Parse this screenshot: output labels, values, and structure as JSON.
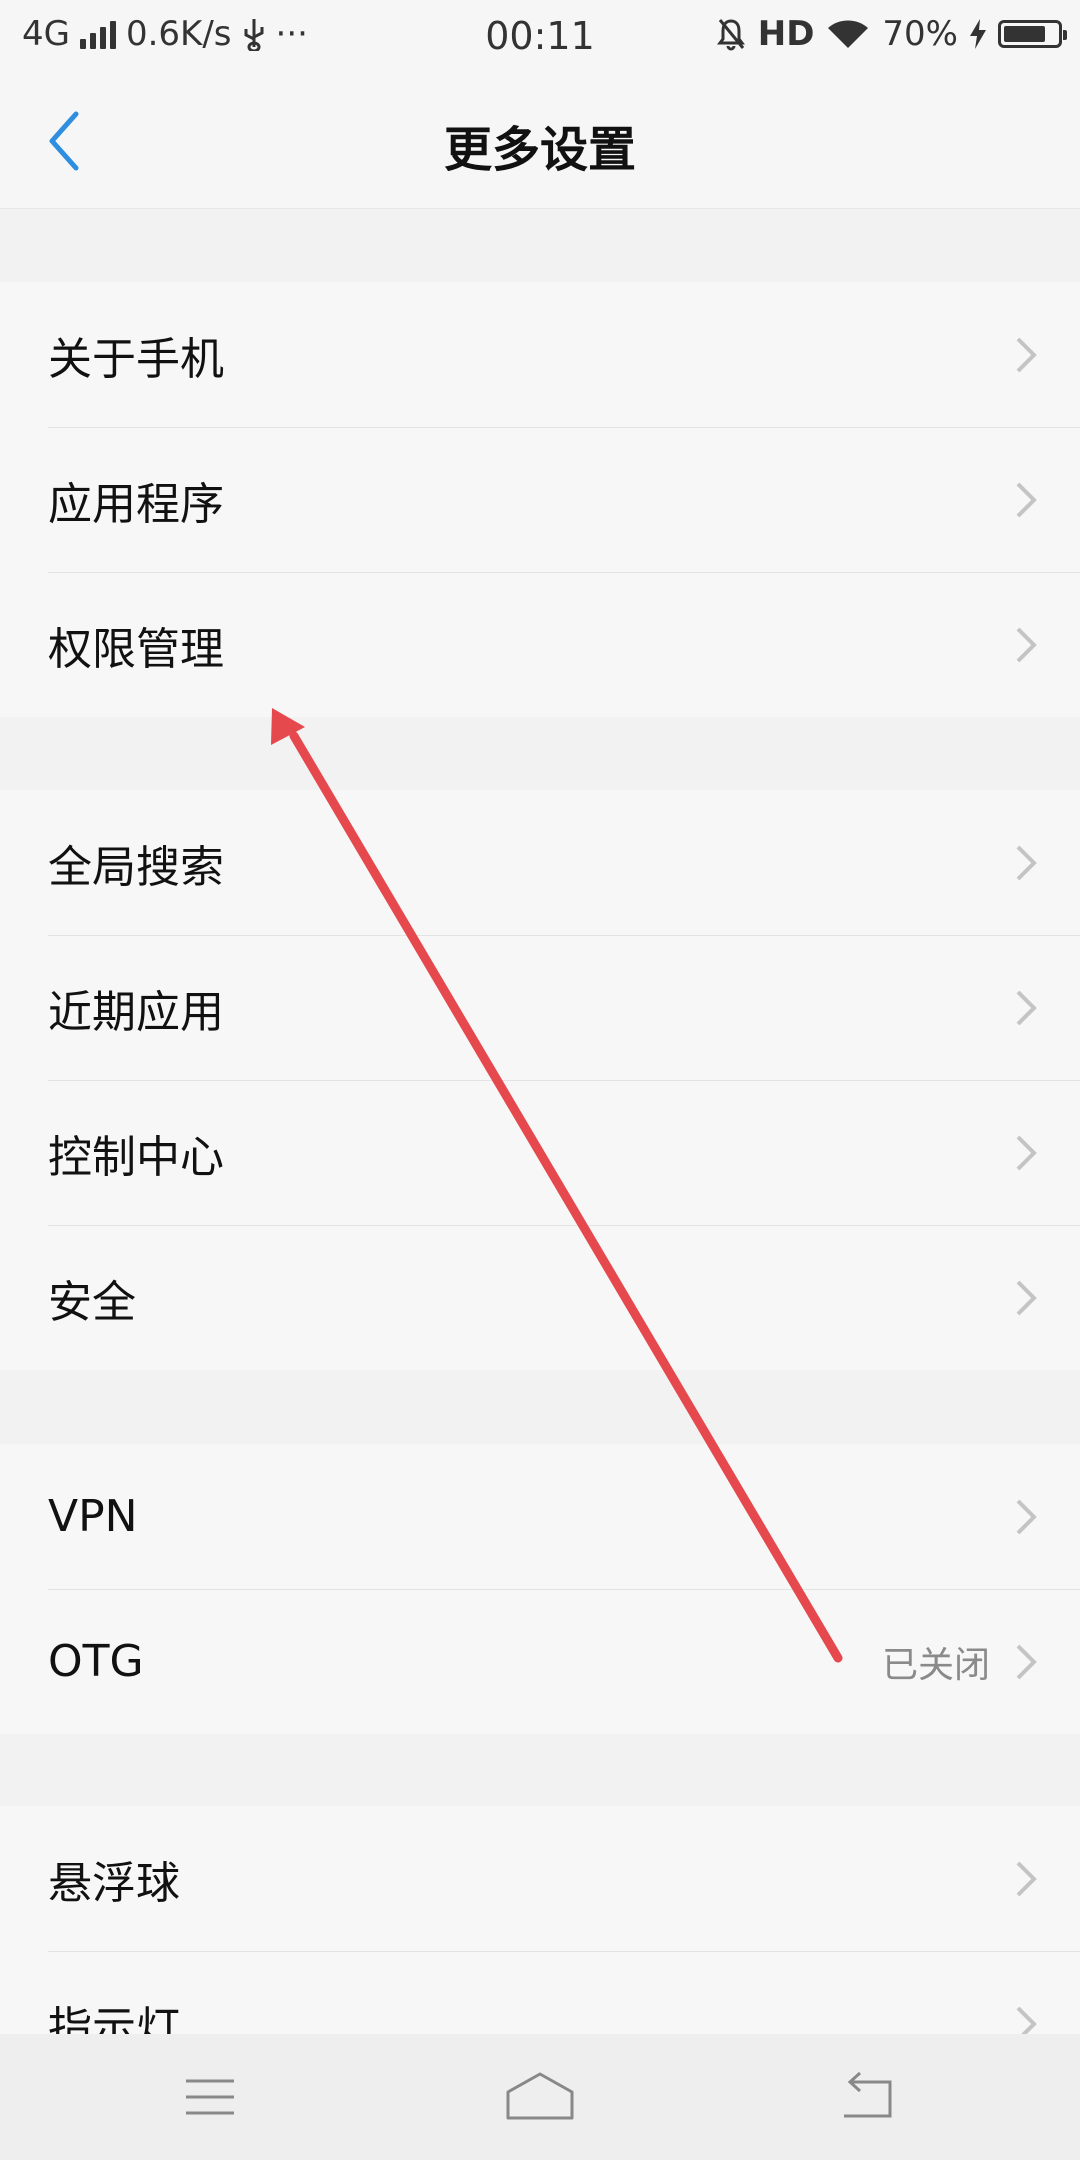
{
  "status_bar": {
    "network": "4G",
    "speed": "0.6K/s",
    "more": "···",
    "time": "00:11",
    "hd": "HD",
    "battery": "70%"
  },
  "header": {
    "title": "更多设置"
  },
  "sections": [
    {
      "items": [
        {
          "label": "关于手机"
        },
        {
          "label": "应用程序"
        },
        {
          "label": "权限管理"
        }
      ]
    },
    {
      "items": [
        {
          "label": "全局搜索"
        },
        {
          "label": "近期应用"
        },
        {
          "label": "控制中心"
        },
        {
          "label": "安全"
        }
      ]
    },
    {
      "items": [
        {
          "label": "VPN"
        },
        {
          "label": "OTG",
          "value": "已关闭"
        }
      ]
    },
    {
      "items": [
        {
          "label": "悬浮球"
        },
        {
          "label": "指示灯"
        }
      ]
    }
  ],
  "colors": {
    "accent": "#2e8ee0",
    "annotation_arrow": "#e5484d",
    "chevron": "#c4c4c4"
  },
  "icons": {
    "back": "back-chevron-icon",
    "row_chevron": "chevron-right-icon",
    "nav_menu": "menu-icon",
    "nav_home": "home-icon",
    "nav_back": "back-icon"
  }
}
